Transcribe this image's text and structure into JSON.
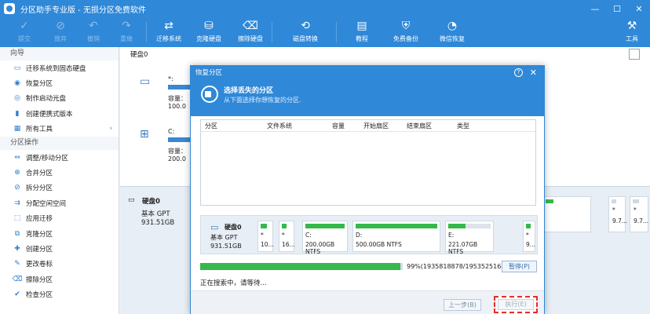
{
  "window": {
    "title": "分区助手专业版 - 无损分区免费软件"
  },
  "toolbar": {
    "items": [
      {
        "label": "提交",
        "icon": "check-icon"
      },
      {
        "label": "放弃",
        "icon": "cancel-icon"
      },
      {
        "label": "撤销",
        "icon": "undo-icon"
      },
      {
        "label": "重做",
        "icon": "redo-icon"
      },
      {
        "label": "迁移系统",
        "icon": "migrate-icon"
      },
      {
        "label": "克隆硬盘",
        "icon": "clone-disk-icon"
      },
      {
        "label": "擦除硬盘",
        "icon": "wipe-disk-icon"
      },
      {
        "label": "磁盘转换",
        "icon": "convert-disk-icon"
      },
      {
        "label": "教程",
        "icon": "tutorial-icon"
      },
      {
        "label": "免费备份",
        "icon": "backup-icon"
      },
      {
        "label": "微信恢复",
        "icon": "wechat-restore-icon"
      },
      {
        "label": "工具",
        "icon": "tools-icon"
      }
    ]
  },
  "sidebar": {
    "wizard_title": "向导",
    "wizard_items": [
      {
        "label": "迁移系统到固态硬盘",
        "icon": "migrate-icon"
      },
      {
        "label": "恢复分区",
        "icon": "recover-icon"
      },
      {
        "label": "制作启动光盘",
        "icon": "disc-icon"
      },
      {
        "label": "创建便携式版本",
        "icon": "portable-icon"
      },
      {
        "label": "所有工具",
        "icon": "tools-icon"
      }
    ],
    "ops_title": "分区操作",
    "ops_items": [
      {
        "label": "调整/移动分区",
        "icon": "resize-icon"
      },
      {
        "label": "合并分区",
        "icon": "merge-icon"
      },
      {
        "label": "拆分分区",
        "icon": "split-icon"
      },
      {
        "label": "分配空闲空间",
        "icon": "allocate-icon"
      },
      {
        "label": "应用迁移",
        "icon": "app-migrate-icon"
      },
      {
        "label": "克隆分区",
        "icon": "clone-icon"
      },
      {
        "label": "创建分区",
        "icon": "create-icon"
      },
      {
        "label": "更改卷标",
        "icon": "label-icon"
      },
      {
        "label": "擦除分区",
        "icon": "wipe-icon"
      },
      {
        "label": "检查分区",
        "icon": "check-partition-icon"
      }
    ]
  },
  "main": {
    "disk_label": "硬盘0",
    "disk_cards": [
      {
        "name": "*:",
        "capacity": "容量：100.0"
      },
      {
        "name": "C:",
        "capacity": "容量：200.0"
      }
    ],
    "bottom": {
      "disk_name": "硬盘0",
      "type": "基本 GPT",
      "size": "931.51GB"
    },
    "right_strip": [
      {
        "top": "",
        "bottom": ""
      },
      {
        "top": "*",
        "bottom": "9.7..."
      },
      {
        "top": "*",
        "bottom": "9.7..."
      }
    ]
  },
  "dialog": {
    "title": "恢复分区",
    "heading": "选择丢失的分区",
    "subheading": "从下面选择你想恢复的分区.",
    "columns": [
      "分区",
      "文件系统",
      "容量",
      "开始扇区",
      "结束扇区",
      "类型"
    ],
    "diskmap": {
      "disk_name": "硬盘0",
      "disk_type": "基本 GPT",
      "disk_size": "931.51GB",
      "partitions": [
        {
          "label": "*",
          "size": "10..."
        },
        {
          "label": "*",
          "size": "16..."
        },
        {
          "label": "C:",
          "size": "200.00GB NTFS"
        },
        {
          "label": "D:",
          "size": "500.00GB NTFS"
        },
        {
          "label": "E:",
          "size": "221.07GB NTFS"
        },
        {
          "label": "*",
          "size": "9..."
        }
      ]
    },
    "progress": {
      "percent": 99,
      "text": "99%(1935818878/1953525168)"
    },
    "pause_label": "暂停(P)",
    "status": "正在搜索中，请等待...",
    "prev_label": "上一步(B)",
    "exec_label": "执行(E)",
    "accent_color": "#2f88d8",
    "highlight_color": "#e0302a"
  }
}
